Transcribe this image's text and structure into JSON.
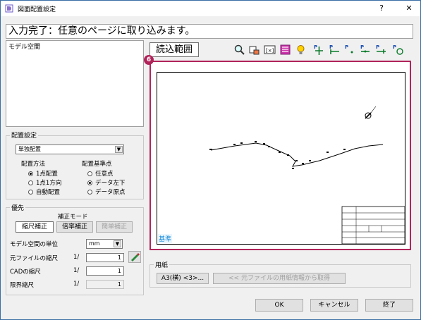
{
  "window": {
    "title": "図面配置設定",
    "help": "?",
    "close": "✕"
  },
  "status_text": "入力完了：任意のページに取り込みます。",
  "space_list": [
    "モデル空間"
  ],
  "toolbar": {
    "read_range_label": "読込範囲",
    "icons": [
      "zoom-icon",
      "fit-icon",
      "zoom-window-icon",
      "layer-icon",
      "bulb-icon",
      "point-center-icon",
      "point-left-icon",
      "point-bottom-icon",
      "point-right-icon",
      "point-top-icon",
      "point-origin-icon"
    ]
  },
  "callout_number": "6",
  "canvas": {
    "kijun_label": "基準"
  },
  "placement": {
    "group_title": "配置設定",
    "mode_value": "単独配置",
    "method_title": "配置方法",
    "method_options": [
      "1点配置",
      "1点1方向",
      "自動配置"
    ],
    "method_selected": 0,
    "base_title": "配置基準点",
    "base_options": [
      "任意点",
      "データ左下",
      "データ原点"
    ],
    "base_selected": 1
  },
  "priority": {
    "group_title": "優先",
    "correction_mode_title": "補正モード",
    "buttons": [
      "縮尺補正",
      "倍率補正",
      "簡単補正"
    ],
    "model_unit_label": "モデル空間の単位",
    "model_unit_value": "mm",
    "source_scale_label": "元ファイルの縮尺",
    "source_scale_prefix": "1/",
    "source_scale_value": "1",
    "cad_scale_label": "CADの縮尺",
    "cad_scale_prefix": "1/",
    "cad_scale_value": "1",
    "limit_scale_label": "限界縮尺",
    "limit_scale_prefix": "1/",
    "limit_scale_value": "1"
  },
  "paper": {
    "group_title": "用紙",
    "size_button": "A3(横) <3>...",
    "fetch_button": "<<  元ファイルの用紙情報から取得"
  },
  "footer": {
    "ok": "OK",
    "cancel": "キャンセル",
    "finish": "終了"
  },
  "colors": {
    "accent": "#b0245a",
    "kijun": "#1a8cd8"
  }
}
